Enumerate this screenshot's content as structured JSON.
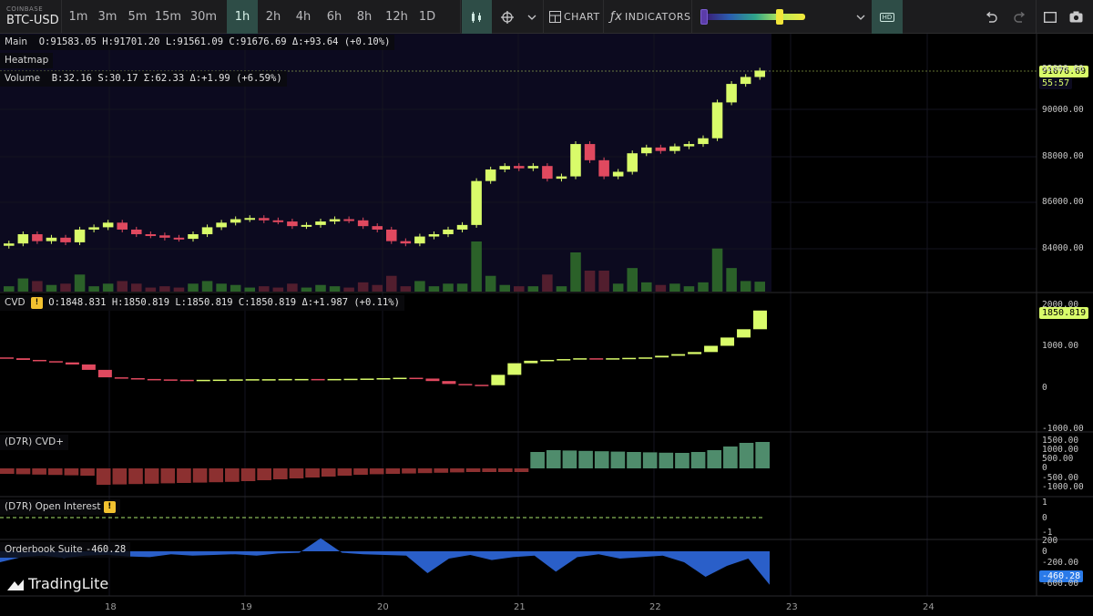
{
  "toolbar": {
    "exchange": "COINBASE",
    "pair": "BTC-USD",
    "timeframes": [
      "1m",
      "3m",
      "5m",
      "15m",
      "30m",
      "1h",
      "2h",
      "4h",
      "6h",
      "8h",
      "12h",
      "1D"
    ],
    "active_timeframe": "1h",
    "chart_label": "CHART",
    "indicators_label": "INDICATORS",
    "hd_label": "HD",
    "heatmap_slider": {
      "low": 0.0,
      "high": 0.87
    },
    "icons": [
      "candles-icon",
      "crosshair-icon",
      "chevron-down-icon",
      "chart-icon",
      "fx-icon",
      "undo-icon",
      "redo-icon",
      "fullscreen-icon",
      "camera-icon"
    ]
  },
  "main_panel": {
    "legend": {
      "name": "Main",
      "o": "O:91583.05",
      "h": "H:91701.20",
      "l": "L:91561.09",
      "c": "C:91676.69",
      "delta": "Δ:+93.64 (+0.10%)"
    },
    "heatmap_label": "Heatmap",
    "volume_legend": {
      "name": "Volume",
      "b": "B:32.16",
      "s": "S:30.17",
      "sum": "Σ:62.33",
      "delta": "Δ:+1.99 (+6.59%)"
    },
    "price_tag": "91676.69",
    "countdown": "55:57",
    "axis": [
      "92000.00",
      "90000.00",
      "88000.00",
      "86000.00",
      "84000.00"
    ]
  },
  "cvd_panel": {
    "legend": {
      "name": "CVD",
      "o": "O:1848.831",
      "h": "H:1850.819",
      "l": "L:1850.819",
      "c": "C:1850.819",
      "delta": "Δ:+1.987 (+0.11%)"
    },
    "value_tag": "1850.819",
    "axis": [
      "2000.00",
      "1000.00",
      "0",
      "-1000.00"
    ]
  },
  "cvdplus_panel": {
    "legend": "(D7R) CVD+",
    "axis": [
      "1500.00",
      "1000.00",
      "500.00",
      "0",
      "-500.00",
      "-1000.00"
    ]
  },
  "oi_panel": {
    "legend": "(D7R) Open Interest",
    "axis": [
      "1",
      "0",
      "-1"
    ]
  },
  "orderbook_panel": {
    "legend": "Orderbook Suite",
    "value": "-460.28",
    "value_tag": "-460.28",
    "axis": [
      "200",
      "0",
      "-200.00",
      "-400",
      "-600.00"
    ]
  },
  "date_axis": [
    "18",
    "19",
    "20",
    "21",
    "22",
    "23",
    "24"
  ],
  "brand": "TradingLite",
  "colors": {
    "up": "#d9fb6a",
    "down": "#e0495f",
    "accent": "#2e4d47",
    "ob_fill": "#2a5fc9"
  },
  "chart_data": {
    "type": "candlestick",
    "symbol": "BTC-USD",
    "timeframe": "1h",
    "last": {
      "open": 91583.05,
      "high": 91701.2,
      "low": 91561.09,
      "close": 91676.69
    },
    "close_series": [
      84200,
      84600,
      84300,
      84450,
      84250,
      84800,
      84900,
      85100,
      84800,
      84600,
      84550,
      84450,
      84400,
      84600,
      84900,
      85100,
      85250,
      85300,
      85200,
      85150,
      84950,
      85000,
      85150,
      85250,
      85200,
      84950,
      84800,
      84300,
      84200,
      84500,
      84600,
      84800,
      85000,
      86900,
      87400,
      87550,
      87450,
      87550,
      87000,
      87100,
      88500,
      87800,
      87100,
      87300,
      88100,
      88350,
      88200,
      88400,
      88500,
      88750,
      90300,
      91100,
      91400,
      91676.69
    ],
    "cvd_close": 1850.819,
    "cvd_series": [
      700,
      660,
      630,
      600,
      550,
      420,
      240,
      220,
      200,
      190,
      180,
      175,
      180,
      185,
      190,
      195,
      195,
      200,
      200,
      195,
      200,
      205,
      210,
      220,
      230,
      210,
      150,
      80,
      60,
      50,
      300,
      580,
      640,
      660,
      680,
      700,
      690,
      700,
      710,
      720,
      760,
      800,
      850,
      1000,
      1200,
      1400,
      1850.819
    ],
    "cvdplus_series": [
      -300,
      -320,
      -340,
      -360,
      -380,
      -400,
      -900,
      -880,
      -860,
      -840,
      -820,
      -800,
      -780,
      -760,
      -740,
      -700,
      -650,
      -600,
      -550,
      -500,
      -450,
      -400,
      -350,
      -320,
      -300,
      -280,
      -260,
      -240,
      -220,
      -200,
      -200,
      -200,
      -200,
      900,
      1000,
      980,
      960,
      940,
      920,
      900,
      880,
      860,
      850,
      900,
      1000,
      1200,
      1400,
      1450
    ],
    "orderbook_series": [
      -150,
      -80,
      -60,
      -90,
      -60,
      -50,
      -70,
      -80,
      -40,
      -60,
      -50,
      -40,
      -60,
      -30,
      -20,
      180,
      -20,
      -40,
      -50,
      -60,
      -300,
      -100,
      -50,
      -120,
      -80,
      -60,
      -280,
      -80,
      -40,
      -100,
      -80,
      -60,
      -150,
      -350,
      -200,
      -100,
      -460.28
    ],
    "volume_note_axis": "price"
  }
}
